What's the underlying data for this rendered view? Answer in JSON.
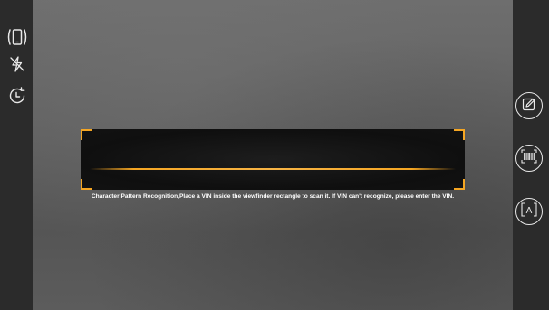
{
  "scanner": {
    "instruction": "Character Pattern Recognition,Place a VIN inside the viewfinder rectangle to scan it. If VIN can't recognize, please enter the VIN.",
    "mode": "Character Pattern Recognition"
  },
  "left_toolbar": {
    "icons": [
      "rotate-screen-icon",
      "flash-off-icon",
      "history-icon"
    ]
  },
  "right_toolbar": {
    "buttons": [
      "manual-input-edit-icon",
      "barcode-scan-icon",
      "character-recognition-icon"
    ],
    "character_button_glyph": "A"
  },
  "colors": {
    "accent": "#f5a623",
    "toolbar_bg": "#2b2b2b",
    "icon": "#e8e8e8"
  }
}
